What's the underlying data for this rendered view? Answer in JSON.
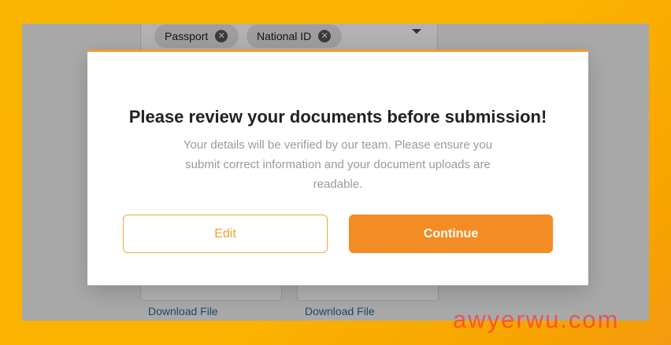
{
  "background_form": {
    "document_types": [
      {
        "label": "Passport",
        "remove_icon": "close-circle-icon"
      },
      {
        "label": "National ID",
        "remove_icon": "close-circle-icon"
      }
    ],
    "dropdown_icon": "caret-down-icon",
    "download_links": [
      "Download File",
      "Download File"
    ]
  },
  "modal": {
    "title": "Please review your documents before submission!",
    "body": "Your details will be verified by our team. Please ensure you submit correct information and your document uploads are readable.",
    "edit_label": "Edit",
    "continue_label": "Continue",
    "accent_color": "#f48c24"
  },
  "watermark": "awyerwu.com"
}
